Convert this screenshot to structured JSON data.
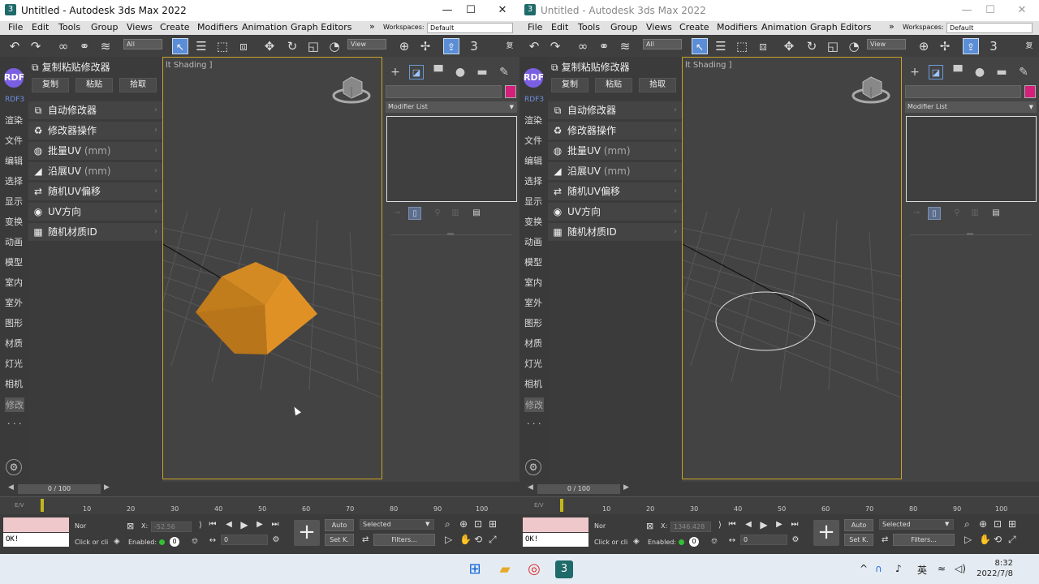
{
  "windows": [
    {
      "id": "left",
      "title": "Untitled - Autodesk 3ds Max 2022",
      "active": true,
      "viewport_label": "lt Shading ]",
      "status_x_value": "-52.56"
    },
    {
      "id": "right",
      "title": "Untitled - Autodesk 3ds Max 2022",
      "active": false,
      "viewport_label": "lt Shading ]",
      "status_x_value": "1346.428"
    }
  ],
  "window_controls": {
    "minimize": "—",
    "maximize": "☐",
    "close": "✕"
  },
  "menu": [
    "File",
    "Edit",
    "Tools",
    "Group",
    "Views",
    "Create",
    "Modifiers",
    "Animation",
    "Graph Editors"
  ],
  "workspaces": {
    "label": "Workspaces:",
    "value": "Default"
  },
  "toolbar": {
    "filter_value": "All",
    "view_value": "View"
  },
  "left_sidebar": {
    "logo": "RDF",
    "version": "RDF3",
    "items": [
      "渲染",
      "文件",
      "编辑",
      "选择",
      "显示",
      "变换",
      "动画",
      "模型",
      "室内",
      "室外",
      "图形",
      "材质",
      "灯光",
      "相机",
      "修改"
    ],
    "active_item": "修改",
    "more": "· · ·"
  },
  "plugin_panel": {
    "header": "复制粘贴修改器",
    "buttons": [
      "复制",
      "粘贴",
      "拾取"
    ],
    "items": [
      {
        "label": "自动修改器",
        "unit": "",
        "icon": "copy-icon"
      },
      {
        "label": "修改器操作",
        "unit": "",
        "icon": "recycle-icon"
      },
      {
        "label": "批量UV",
        "unit": " (mm)",
        "icon": "globe-icon"
      },
      {
        "label": "沿展UV",
        "unit": " (mm)",
        "icon": "unwrap-icon"
      },
      {
        "label": "随机UV偏移",
        "unit": "",
        "icon": "shuffle-icon"
      },
      {
        "label": "UV方向",
        "unit": "",
        "icon": "compass-icon"
      },
      {
        "label": "随机材质ID",
        "unit": "",
        "icon": "grid-icon"
      }
    ]
  },
  "command_panel": {
    "modifier_list": "Modifier List",
    "object_color": "#d4207a"
  },
  "timeline": {
    "frame_display": "0 / 100",
    "ticks": [
      "10",
      "20",
      "30",
      "40",
      "50",
      "60",
      "70",
      "80",
      "90",
      "100"
    ],
    "current_frame": 0,
    "mini_label": "E∕V"
  },
  "status_bar": {
    "console_output": "OK!",
    "selection_label": "Nor",
    "prompt": "Click or cli",
    "x_label": "X:",
    "enabled_label": "Enabled:",
    "enabled_value": "0",
    "auto_key": "Auto",
    "set_key": "Set K.",
    "key_filter": "Selected",
    "filters": "Filters...",
    "spinner_value": "0"
  },
  "taskbar": {
    "tray_lang": "英",
    "time": "8:32",
    "date": "2022/7/8"
  }
}
